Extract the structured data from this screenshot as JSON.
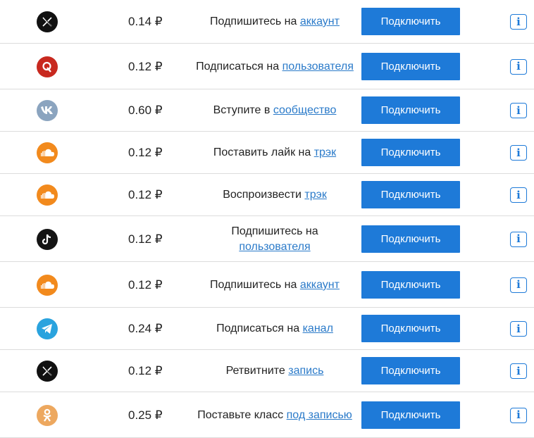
{
  "colors": {
    "button": "#1e7ad8",
    "link": "#2a7ac9",
    "divider": "#dcdcdc"
  },
  "rows": [
    {
      "icon": "x-twitter-icon",
      "price": "0.14 ₽",
      "text": "Подпишитесь на ",
      "link": "аккаунт",
      "button": "Подключить"
    },
    {
      "icon": "quora-icon",
      "price": "0.12 ₽",
      "text": "Подписаться на ",
      "link": "пользователя",
      "button": "Подключить"
    },
    {
      "icon": "vk-icon",
      "price": "0.60 ₽",
      "text": "Вступите в ",
      "link": "сообщество",
      "button": "Подключить"
    },
    {
      "icon": "soundcloud-icon",
      "price": "0.12 ₽",
      "text": "Поставить лайк на ",
      "link": "трэк",
      "button": "Подключить"
    },
    {
      "icon": "soundcloud-icon",
      "price": "0.12 ₽",
      "text": "Воспроизвести ",
      "link": "трэк",
      "button": "Подключить"
    },
    {
      "icon": "tiktok-icon",
      "price": "0.12 ₽",
      "text": "Подпишитесь на ",
      "link": "пользователя",
      "button": "Подключить"
    },
    {
      "icon": "soundcloud-icon",
      "price": "0.12 ₽",
      "text": "Подпишитесь на ",
      "link": "аккаунт",
      "button": "Подключить"
    },
    {
      "icon": "telegram-icon",
      "price": "0.24 ₽",
      "text": "Подписаться на ",
      "link": "канал",
      "button": "Подключить"
    },
    {
      "icon": "x-twitter-icon",
      "price": "0.12 ₽",
      "text": "Ретвитните ",
      "link": "запись",
      "button": "Подключить"
    },
    {
      "icon": "odnoklassniki-icon",
      "price": "0.25 ₽",
      "text": "Поставьте класс ",
      "link": "под записью",
      "button": "Подключить"
    }
  ],
  "info_label": "i"
}
